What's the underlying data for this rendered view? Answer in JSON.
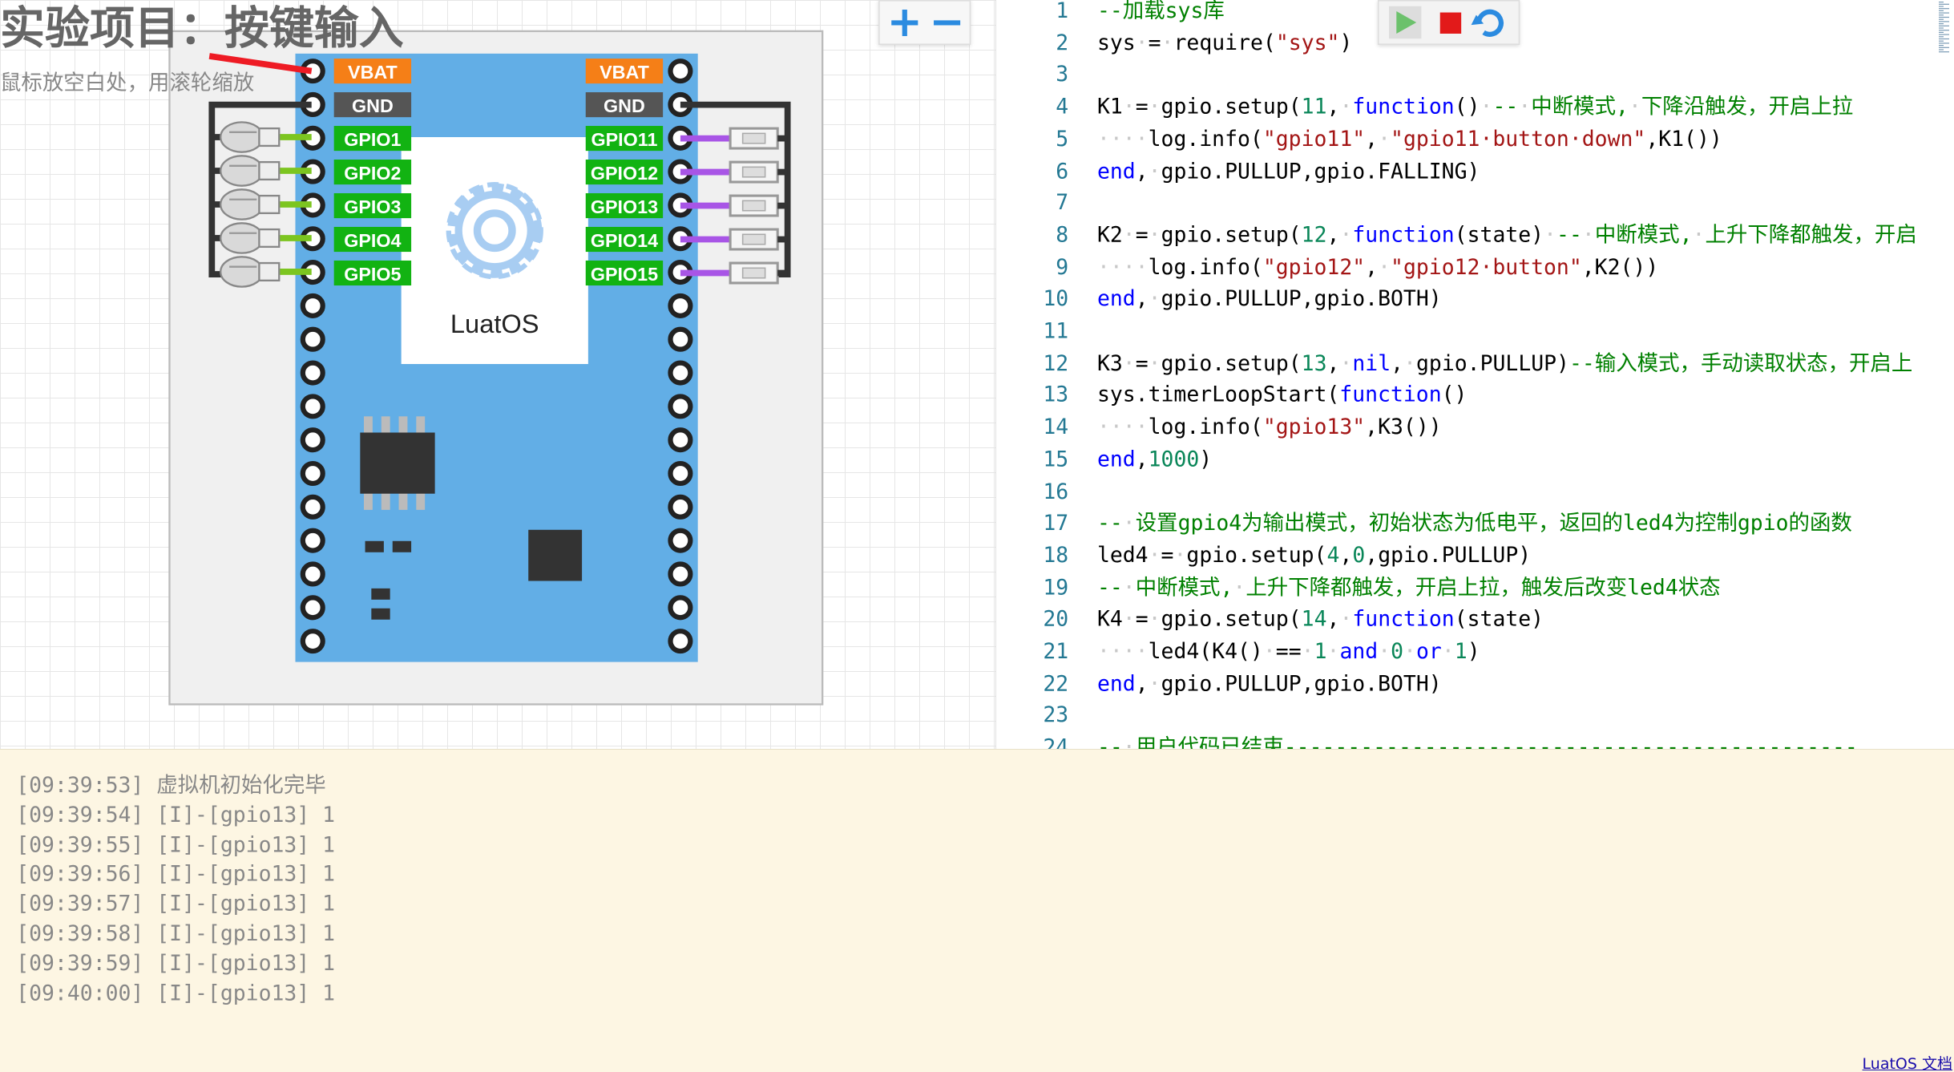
{
  "simulator": {
    "title": "实验项目：按键输入",
    "hint": "鼠标放空白处，用滚轮缩放",
    "zoom_in": "+",
    "zoom_out": "−",
    "board_label": "LuatOS",
    "left_pins": [
      "VBAT",
      "GND",
      "GPIO1",
      "GPIO2",
      "GPIO3",
      "GPIO4",
      "GPIO5"
    ],
    "right_pins": [
      "VBAT",
      "GND",
      "GPIO11",
      "GPIO12",
      "GPIO13",
      "GPIO14",
      "GPIO15"
    ],
    "colors": {
      "board": "#62aee6",
      "power_pin": "#f57f17",
      "gnd_pin": "#555555",
      "gpio_pin": "#12b312",
      "led_wire": "#7cc520",
      "button_wire": "#a855e6",
      "vbat_wire": "#ee1b24"
    }
  },
  "editor": {
    "toolbar": {
      "run_icon": "play-icon",
      "stop_icon": "stop-icon",
      "reload_icon": "reload-icon"
    },
    "lines": [
      {
        "n": "1",
        "tokens": [
          [
            "cm",
            "--加载sys库"
          ]
        ]
      },
      {
        "n": "2",
        "tokens": [
          [
            "",
            "sys"
          ],
          [
            "ws",
            "·"
          ],
          [
            "",
            "="
          ],
          [
            "ws",
            "·"
          ],
          [
            "",
            "require("
          ],
          [
            "str",
            "\"sys\""
          ],
          [
            "",
            ")"
          ]
        ]
      },
      {
        "n": "3",
        "tokens": []
      },
      {
        "n": "4",
        "tokens": [
          [
            "",
            "K1"
          ],
          [
            "ws",
            "·"
          ],
          [
            "",
            "="
          ],
          [
            "ws",
            "·"
          ],
          [
            "",
            "gpio.setup("
          ],
          [
            "num",
            "11"
          ],
          [
            "",
            ","
          ],
          [
            "ws",
            "·"
          ],
          [
            "kw",
            "function"
          ],
          [
            "",
            "()"
          ],
          [
            "ws",
            "·"
          ],
          [
            "cm",
            "--"
          ],
          [
            "ws",
            "·"
          ],
          [
            "cm",
            "中断模式,"
          ],
          [
            "ws",
            "·"
          ],
          [
            "cm",
            "下降沿触发，开启上拉"
          ]
        ]
      },
      {
        "n": "5",
        "tokens": [
          [
            "ws",
            "····"
          ],
          [
            "",
            "log.info("
          ],
          [
            "str",
            "\"gpio11\""
          ],
          [
            "",
            ","
          ],
          [
            "ws",
            "·"
          ],
          [
            "str",
            "\"gpio11·button·down\""
          ],
          [
            "",
            ",K1())"
          ]
        ]
      },
      {
        "n": "6",
        "tokens": [
          [
            "kw",
            "end"
          ],
          [
            "",
            ","
          ],
          [
            "ws",
            "·"
          ],
          [
            "",
            "gpio.PULLUP,gpio.FALLING)"
          ]
        ]
      },
      {
        "n": "7",
        "tokens": []
      },
      {
        "n": "8",
        "tokens": [
          [
            "",
            "K2"
          ],
          [
            "ws",
            "·"
          ],
          [
            "",
            "="
          ],
          [
            "ws",
            "·"
          ],
          [
            "",
            "gpio.setup("
          ],
          [
            "num",
            "12"
          ],
          [
            "",
            ","
          ],
          [
            "ws",
            "·"
          ],
          [
            "kw",
            "function"
          ],
          [
            "",
            "(state)"
          ],
          [
            "ws",
            "·"
          ],
          [
            "cm",
            "--"
          ],
          [
            "ws",
            "·"
          ],
          [
            "cm",
            "中断模式,"
          ],
          [
            "ws",
            "·"
          ],
          [
            "cm",
            "上升下降都触发，开启"
          ]
        ]
      },
      {
        "n": "9",
        "tokens": [
          [
            "ws",
            "····"
          ],
          [
            "",
            "log.info("
          ],
          [
            "str",
            "\"gpio12\""
          ],
          [
            "",
            ","
          ],
          [
            "ws",
            "·"
          ],
          [
            "str",
            "\"gpio12·button\""
          ],
          [
            "",
            ",K2())"
          ]
        ]
      },
      {
        "n": "10",
        "tokens": [
          [
            "kw",
            "end"
          ],
          [
            "",
            ","
          ],
          [
            "ws",
            "·"
          ],
          [
            "",
            "gpio.PULLUP,gpio.BOTH)"
          ]
        ]
      },
      {
        "n": "11",
        "tokens": []
      },
      {
        "n": "12",
        "tokens": [
          [
            "",
            "K3"
          ],
          [
            "ws",
            "·"
          ],
          [
            "",
            "="
          ],
          [
            "ws",
            "·"
          ],
          [
            "",
            "gpio.setup("
          ],
          [
            "num",
            "13"
          ],
          [
            "",
            ","
          ],
          [
            "ws",
            "·"
          ],
          [
            "kw",
            "nil"
          ],
          [
            "",
            ","
          ],
          [
            "ws",
            "·"
          ],
          [
            "",
            "gpio.PULLUP)"
          ],
          [
            "cm",
            "--输入模式，手动读取状态，开启上"
          ]
        ]
      },
      {
        "n": "13",
        "tokens": [
          [
            "",
            "sys.timerLoopStart("
          ],
          [
            "kw",
            "function"
          ],
          [
            "",
            "()"
          ]
        ]
      },
      {
        "n": "14",
        "tokens": [
          [
            "ws",
            "····"
          ],
          [
            "",
            "log.info("
          ],
          [
            "str",
            "\"gpio13\""
          ],
          [
            "",
            ",K3())"
          ]
        ]
      },
      {
        "n": "15",
        "tokens": [
          [
            "kw",
            "end"
          ],
          [
            "",
            ","
          ],
          [
            "num",
            "1000"
          ],
          [
            "",
            ")"
          ]
        ]
      },
      {
        "n": "16",
        "tokens": []
      },
      {
        "n": "17",
        "tokens": [
          [
            "cm",
            "--"
          ],
          [
            "ws",
            "·"
          ],
          [
            "cm",
            "设置gpio4为输出模式，初始状态为低电平，返回的led4为控制gpio的函数"
          ]
        ]
      },
      {
        "n": "18",
        "tokens": [
          [
            "",
            "led4"
          ],
          [
            "ws",
            "·"
          ],
          [
            "",
            "="
          ],
          [
            "ws",
            "·"
          ],
          [
            "",
            "gpio.setup("
          ],
          [
            "num",
            "4"
          ],
          [
            "",
            ","
          ],
          [
            "num",
            "0"
          ],
          [
            "",
            ",gpio.PULLUP)"
          ]
        ]
      },
      {
        "n": "19",
        "tokens": [
          [
            "cm",
            "--"
          ],
          [
            "ws",
            "·"
          ],
          [
            "cm",
            "中断模式,"
          ],
          [
            "ws",
            "·"
          ],
          [
            "cm",
            "上升下降都触发，开启上拉，触发后改变led4状态"
          ]
        ]
      },
      {
        "n": "20",
        "tokens": [
          [
            "",
            "K4"
          ],
          [
            "ws",
            "·"
          ],
          [
            "",
            "="
          ],
          [
            "ws",
            "·"
          ],
          [
            "",
            "gpio.setup("
          ],
          [
            "num",
            "14"
          ],
          [
            "",
            ","
          ],
          [
            "ws",
            "·"
          ],
          [
            "kw",
            "function"
          ],
          [
            "",
            "(state)"
          ]
        ]
      },
      {
        "n": "21",
        "tokens": [
          [
            "ws",
            "····"
          ],
          [
            "",
            "led4(K4()"
          ],
          [
            "ws",
            "·"
          ],
          [
            "",
            "=="
          ],
          [
            "ws",
            "·"
          ],
          [
            "num",
            "1"
          ],
          [
            "ws",
            "·"
          ],
          [
            "kw",
            "and"
          ],
          [
            "ws",
            "·"
          ],
          [
            "num",
            "0"
          ],
          [
            "ws",
            "·"
          ],
          [
            "kw",
            "or"
          ],
          [
            "ws",
            "·"
          ],
          [
            "num",
            "1"
          ],
          [
            "",
            ")"
          ]
        ]
      },
      {
        "n": "22",
        "tokens": [
          [
            "kw",
            "end"
          ],
          [
            "",
            ","
          ],
          [
            "ws",
            "·"
          ],
          [
            "",
            "gpio.PULLUP,gpio.BOTH)"
          ]
        ]
      },
      {
        "n": "23",
        "tokens": []
      },
      {
        "n": "24",
        "tokens": [
          [
            "cm",
            "--"
          ],
          [
            "ws",
            "·"
          ],
          [
            "cm",
            "用户代码已结束---------------------------------------------"
          ]
        ]
      }
    ]
  },
  "console": {
    "lines": [
      "[09:39:53] 虚拟机初始化完毕",
      "[09:39:54] [I]-[gpio13] 1",
      "[09:39:55] [I]-[gpio13] 1",
      "[09:39:56] [I]-[gpio13] 1",
      "[09:39:57] [I]-[gpio13] 1",
      "[09:39:58] [I]-[gpio13] 1",
      "[09:39:59] [I]-[gpio13] 1",
      "[09:40:00] [I]-[gpio13] 1"
    ],
    "docs_link": "LuatOS 文档"
  }
}
